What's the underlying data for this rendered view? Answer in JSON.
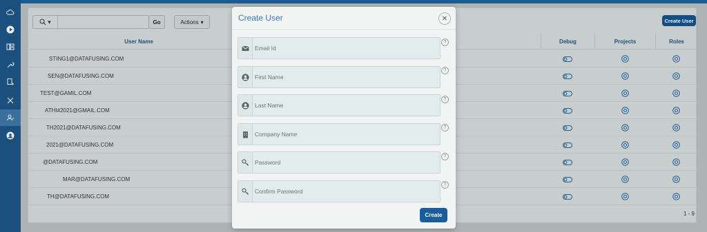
{
  "colors": {
    "sidebar": "#1a4f7e",
    "accent": "#1a5d9c",
    "title": "#3a7ab8"
  },
  "sidebar": {
    "items": [
      {
        "icon": "cloud-icon"
      },
      {
        "icon": "play-icon"
      },
      {
        "icon": "dashboard-icon"
      },
      {
        "icon": "wrench-icon"
      },
      {
        "icon": "document-add-icon"
      },
      {
        "icon": "tools-icon"
      },
      {
        "icon": "user-edit-icon"
      },
      {
        "icon": "user-circle-icon"
      }
    ]
  },
  "toolbar": {
    "go_label": "Go",
    "actions_label": "Actions",
    "create_user_label": "Create User"
  },
  "table": {
    "headers": {
      "user_name": "User Name",
      "debug": "Debug",
      "projects": "Projects",
      "roles": "Roles"
    },
    "rows": [
      {
        "email": "STING1@DATAFUSING.COM"
      },
      {
        "email": "SEN@DATAFUSING.COM"
      },
      {
        "email": "TEST@GAMIL.COM"
      },
      {
        "email": "ATHI#2021@GMAIL.COM"
      },
      {
        "email": "TH2021@DATAFUSING.COM"
      },
      {
        "email": "2021@DATAFUSING.COM"
      },
      {
        "email": "@DATAFUSING.COM"
      },
      {
        "email": "MAR@DATAFUSING.COM"
      },
      {
        "email": "TH@DATAFUSING.COM"
      }
    ],
    "pagination": "1 - 9"
  },
  "modal": {
    "title": "Create User",
    "close_label": "✕",
    "fields": [
      {
        "placeholder": "Email Id",
        "icon": "envelope-icon"
      },
      {
        "placeholder": "First Name",
        "icon": "user-icon"
      },
      {
        "placeholder": "Last Name",
        "icon": "user-icon"
      },
      {
        "placeholder": "Company Name",
        "icon": "building-icon"
      },
      {
        "placeholder": "Password",
        "icon": "key-icon"
      },
      {
        "placeholder": "Confirm Password",
        "icon": "key-icon"
      }
    ],
    "help_label": "?",
    "create_label": "Create"
  }
}
